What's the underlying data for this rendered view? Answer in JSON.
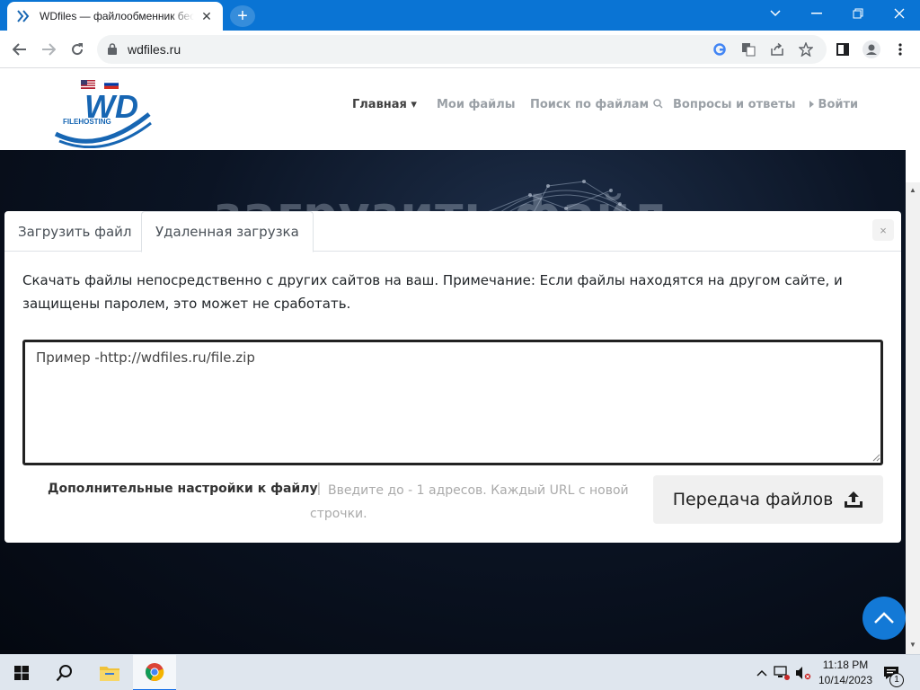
{
  "browser": {
    "tab_title": "WDfiles — файлообменник бесплатно",
    "tab_close": "✕",
    "new_tab": "+",
    "url": "wdfiles.ru"
  },
  "site": {
    "logo_text": "WD",
    "logo_sub": "FILEHOSTING",
    "nav": [
      {
        "label": "Главная ▾"
      },
      {
        "label": "Мои файлы"
      },
      {
        "label": "Поиск по файлам"
      },
      {
        "label": "Вопросы и ответы"
      },
      {
        "label": "Войти"
      }
    ],
    "hero_text": "загрузить файл"
  },
  "modal": {
    "tabs": [
      {
        "label": "Загрузить файл"
      },
      {
        "label": "Удаленная загрузка"
      }
    ],
    "close": "×",
    "description": "Скачать файлы непосредственно с других сайтов на ваш. Примечание: Если файлы находятся на другом сайте, и защищены паролем, это может не сработать.",
    "textarea_placeholder": "Пример -http://wdfiles.ru/file.zip",
    "advanced_label": "Дополнительные настройки к файлу",
    "separator": "|",
    "hint": "Введите до - 1 адресов. Каждый URL с новой строчки.",
    "transfer_button": "Передача файлов"
  },
  "taskbar": {
    "time": "11:18 PM",
    "date": "10/14/2023",
    "notification_count": "1"
  },
  "colors": {
    "chrome_blue": "#0a74d4",
    "accent": "#1379d6",
    "logo_blue": "#1766b3"
  }
}
